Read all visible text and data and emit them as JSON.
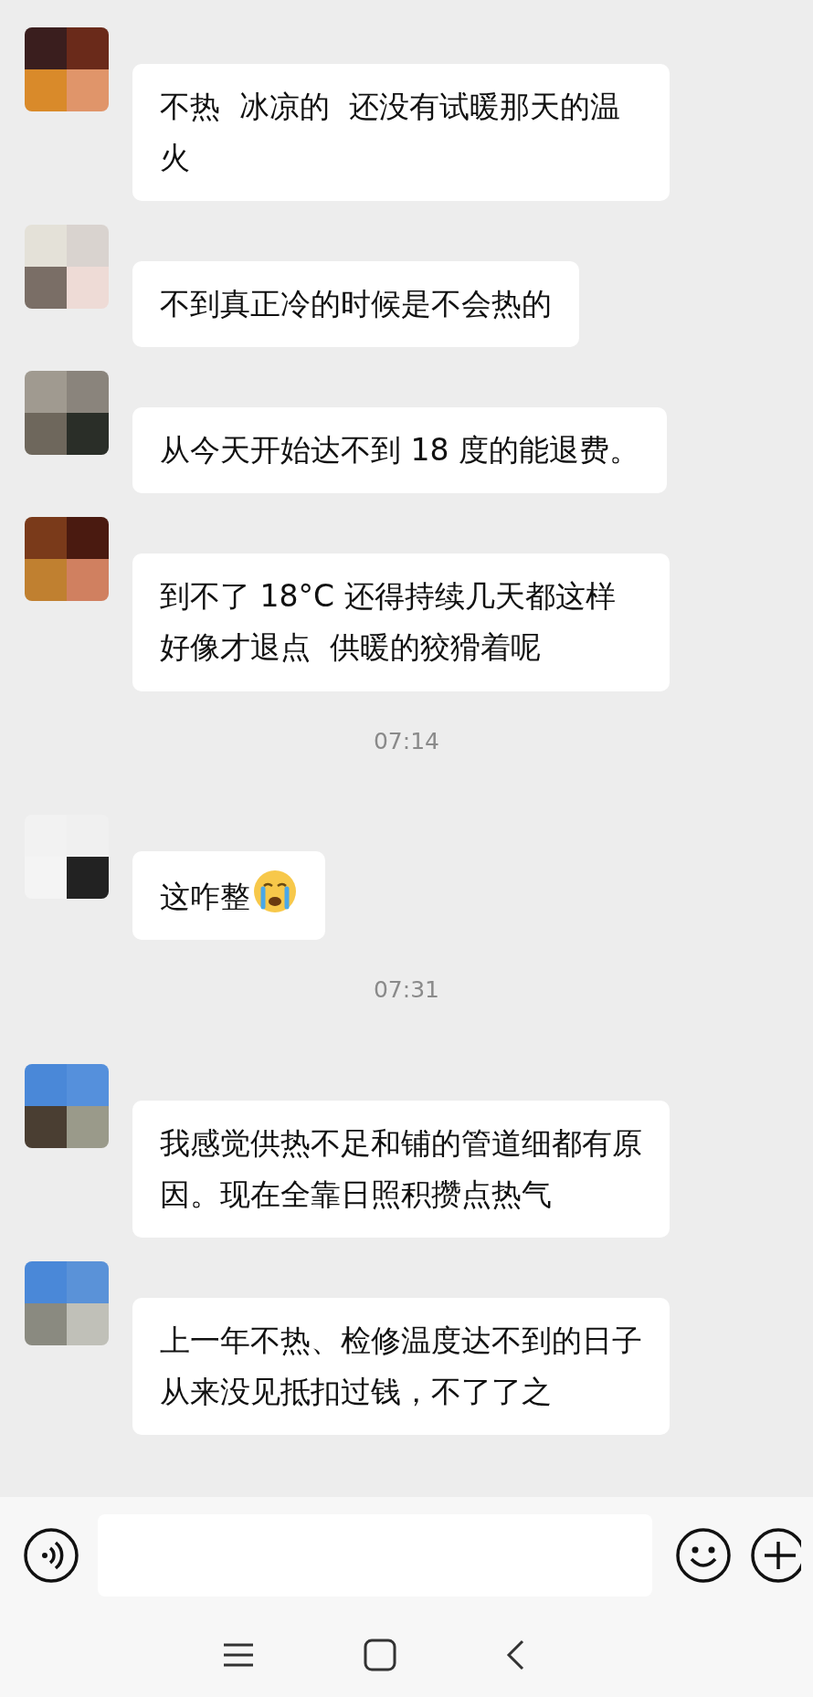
{
  "messages": [
    {
      "kind": "message",
      "text": "不热  冰凉的  还没有试暖那天的温火",
      "trailing_emoji": false
    },
    {
      "kind": "message",
      "text": "不到真正冷的时候是不会热的",
      "trailing_emoji": false
    },
    {
      "kind": "message",
      "text": "从今天开始达不到 18 度的能退费。",
      "trailing_emoji": false
    },
    {
      "kind": "message",
      "text": "到不了 18°C 还得持续几天都这样好像才退点  供暖的狡猾着呢",
      "trailing_emoji": false
    },
    {
      "kind": "time",
      "text": "07:14"
    },
    {
      "kind": "message",
      "text": "这咋整",
      "trailing_emoji": true
    },
    {
      "kind": "time",
      "text": "07:31"
    },
    {
      "kind": "message",
      "text": "我感觉供热不足和铺的管道细都有原因。现在全靠日照积攒点热气",
      "trailing_emoji": false
    },
    {
      "kind": "message",
      "text": "上一年不热、检修温度达不到的日子从来没见抵扣过钱，不了了之",
      "trailing_emoji": false
    }
  ]
}
